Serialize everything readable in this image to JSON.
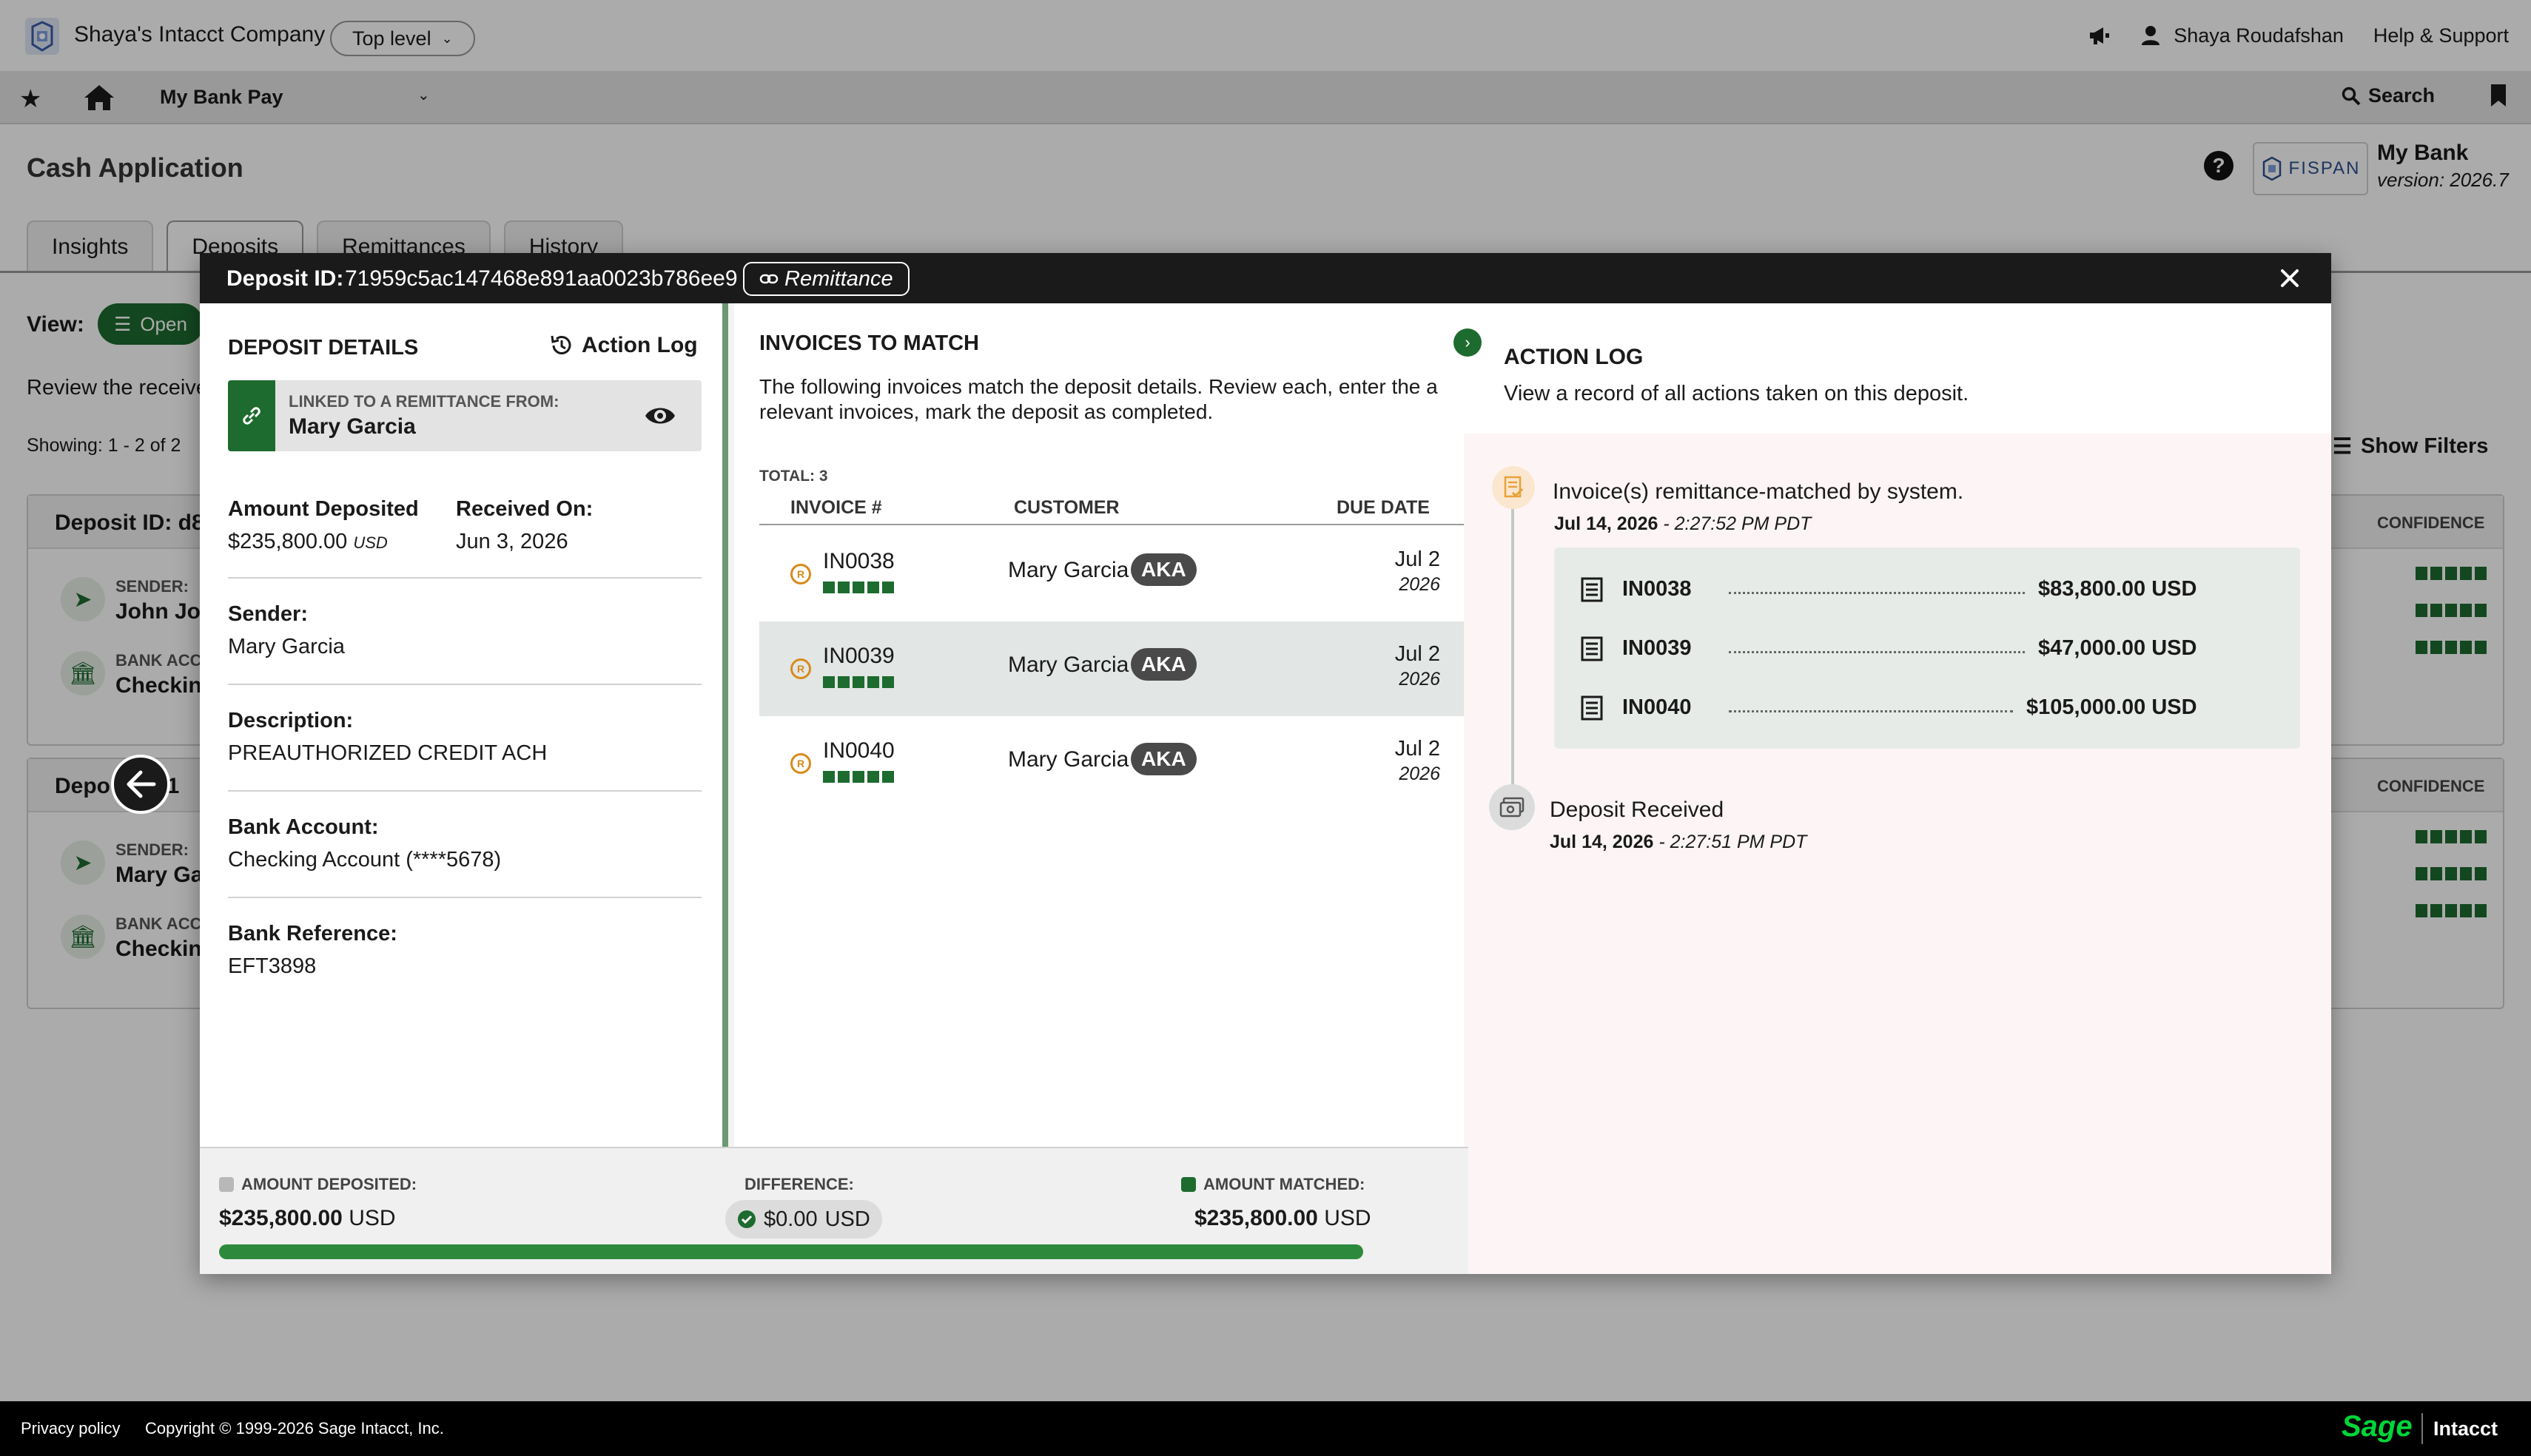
{
  "topbar": {
    "company": "Shaya's Intacct Company",
    "level": "Top level",
    "user": "Shaya Roudafshan",
    "help": "Help & Support"
  },
  "navbar": {
    "app": "My Bank Pay",
    "search": "Search"
  },
  "page": {
    "title": "Cash Application",
    "bank_name": "My Bank",
    "bank_version": "version: 2026.7",
    "fispan": "FISPAN",
    "tabs": [
      "Insights",
      "Deposits",
      "Remittances",
      "History"
    ],
    "view_label": "View:",
    "view_value": "Open",
    "review_text": "Review the receive",
    "showing": "Showing: 1 - 2 of 2",
    "show_filters": "Show Filters",
    "cards": [
      {
        "id": "Deposit ID: d8",
        "confidence": "CONFIDENCE",
        "sender_label": "SENDER:",
        "sender": "John Jor",
        "bank_label": "BANK ACC",
        "bank": "Checkin"
      },
      {
        "id": "Depo",
        "id_tail": "71",
        "confidence": "CONFIDENCE",
        "sender_label": "SENDER:",
        "sender": "Mary Ga",
        "bank_label": "BANK ACC",
        "bank": "Checkin"
      }
    ]
  },
  "modal": {
    "deposit_id_label": "Deposit ID:",
    "deposit_id": "71959c5ac147468e891aa0023b786ee9",
    "remittance_pill": "Remittance",
    "details": {
      "title": "DEPOSIT DETAILS",
      "action_log_link": "Action Log",
      "linked_label": "LINKED TO A REMITTANCE FROM:",
      "linked_name": "Mary Garcia",
      "amount_label": "Amount Deposited",
      "amount_value": "$235,800.00",
      "amount_currency": "USD",
      "received_label": "Received On:",
      "received_value": "Jun 3, 2026",
      "sender_label": "Sender:",
      "sender_value": "Mary Garcia",
      "description_label": "Description:",
      "description_value": "PREAUTHORIZED CREDIT ACH",
      "bank_account_label": "Bank Account:",
      "bank_account_value": "Checking Account (****5678)",
      "bank_ref_label": "Bank Reference:",
      "bank_ref_value": "EFT3898"
    },
    "invoices": {
      "title": "INVOICES TO MATCH",
      "desc_line1": "The following invoices match the deposit details. Review each, enter the a",
      "desc_line2": "relevant invoices, mark the deposit as completed.",
      "total": "TOTAL: 3",
      "columns": [
        "INVOICE #",
        "CUSTOMER",
        "DUE DATE"
      ],
      "rows": [
        {
          "number": "IN0038",
          "customer": "Mary Garcia",
          "badge": "AKA",
          "due_day": "Jul 2",
          "due_year": "2026",
          "confidence": 5,
          "selected": false
        },
        {
          "number": "IN0039",
          "customer": "Mary Garcia",
          "badge": "AKA",
          "due_day": "Jul 2",
          "due_year": "2026",
          "confidence": 5,
          "selected": true
        },
        {
          "number": "IN0040",
          "customer": "Mary Garcia",
          "badge": "AKA",
          "due_day": "Jul 2",
          "due_year": "2026",
          "confidence": 5,
          "selected": false
        }
      ]
    },
    "summary": {
      "deposited_label": "AMOUNT DEPOSITED:",
      "deposited_value": "$235,800.00",
      "deposited_currency": "USD",
      "difference_label": "DIFFERENCE:",
      "difference_value": "$0.00",
      "difference_currency": "USD",
      "matched_label": "AMOUNT MATCHED:",
      "matched_value": "$235,800.00",
      "matched_currency": "USD",
      "matched_fraction": 1.0
    },
    "action_log": {
      "title": "ACTION LOG",
      "subtitle": "View a record of all actions taken on this deposit.",
      "events": [
        {
          "title": "Invoice(s) remittance-matched by system.",
          "date": "Jul 14, 2026",
          "time": "- 2:27:52 PM PDT"
        },
        {
          "title": "Deposit Received",
          "date": "Jul 14, 2026",
          "time": "- 2:27:51 PM PDT"
        }
      ],
      "matches": [
        {
          "invoice": "IN0038",
          "amount": "$83,800.00 USD"
        },
        {
          "invoice": "IN0039",
          "amount": "$47,000.00 USD"
        },
        {
          "invoice": "IN0040",
          "amount": "$105,000.00 USD"
        }
      ]
    }
  },
  "footer": {
    "privacy": "Privacy policy",
    "copyright": "Copyright © 1999-2026 Sage Intacct, Inc.",
    "sage": "Sage",
    "intacct": "Intacct"
  },
  "colors": {
    "brand_green": "#1d6b2f",
    "accent_orange": "#d98a1c",
    "sage_green": "#00d639"
  }
}
